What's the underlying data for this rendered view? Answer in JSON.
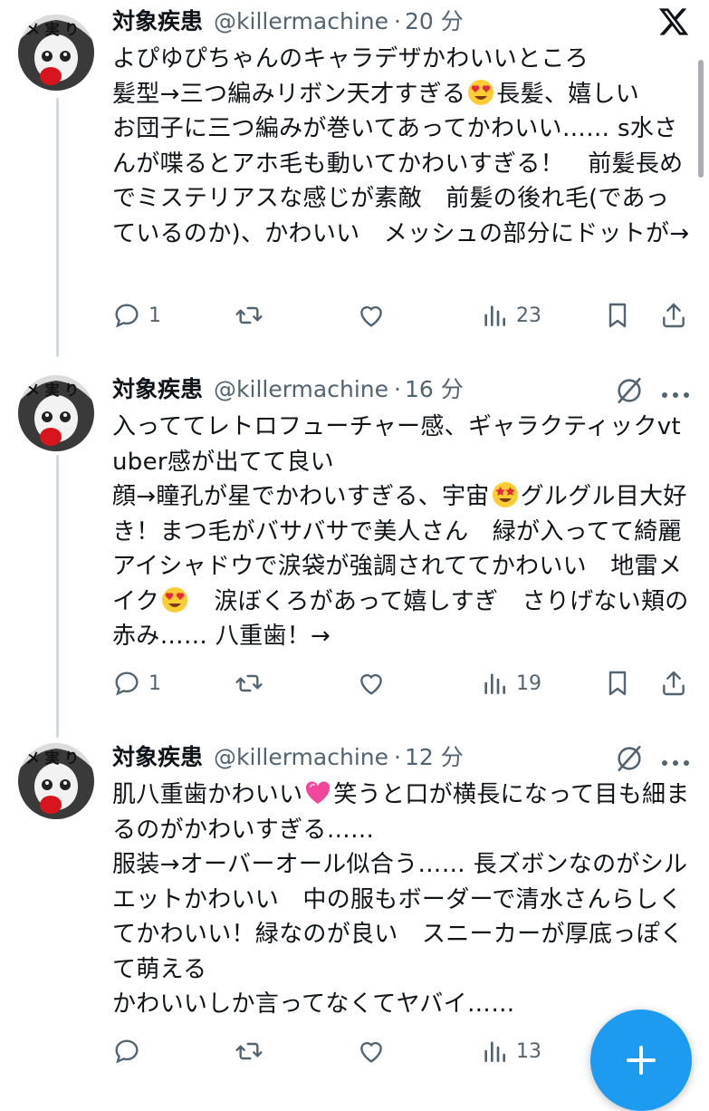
{
  "tweets": [
    {
      "display_name": "対象疾患",
      "handle": "@killermachine",
      "separator": "·",
      "time": "20 分",
      "text_parts": [
        "よぴゆぴちゃんのキャラデザかわいいところ\n髪型→三つ編みリボン天才すぎる",
        "長髪、嬉しい\nお団子に三つ編みが巻いてあってかわいい…… s水さんが喋るとアホ毛も動いてかわいすぎる！　前髪長めでミステリアスな感じが素敵　前髪の後れ毛(であっているのか)、かわいい　メッシュの部分にドットが→"
      ],
      "emojis": [
        "heart-eyes"
      ],
      "replies": "1",
      "reposts": "",
      "likes": "",
      "views": "23",
      "top_right_icon": "x-logo"
    },
    {
      "display_name": "対象疾患",
      "handle": "@killermachine",
      "separator": "·",
      "time": "16 分",
      "text_parts": [
        "入っててレトロフューチャー感、ギャラクティックvtuber感が出てて良い\n顔→瞳孔が星でかわいすぎる、宇宙",
        "グルグル目大好き！まつ毛がバサバサで美人さん　緑が入ってて綺麗　アイシャドウで涙袋が強調されててかわいい　地雷メイク",
        "　涙ぼくろがあって嬉しすぎ　さりげない頬の赤み…… 八重歯！→"
      ],
      "emojis": [
        "star-struck",
        "heart-eyes"
      ],
      "replies": "1",
      "reposts": "",
      "likes": "",
      "views": "19",
      "top_right_icon": "grok-icon"
    },
    {
      "display_name": "対象疾患",
      "handle": "@killermachine",
      "separator": "·",
      "time": "12 分",
      "text_parts": [
        "肌八重歯かわいい",
        "笑うと口が横長になって目も細まるのがかわいすぎる……\n服装→オーバーオール似合う…… 長ズボンなのがシルエットかわいい　中の服もボーダーで清水さんらしくてかわいい！緑なのが良い　スニーカーが厚底っぽくて萌える\nかわいいしか言ってなくてヤバイ……"
      ],
      "emojis": [
        "pink-heart"
      ],
      "replies": "",
      "reposts": "",
      "likes": "",
      "views": "13",
      "top_right_icon": "grok-icon"
    }
  ],
  "colors": {
    "text": "#0f1419",
    "secondary": "#536471",
    "thread_line": "#cfd9de",
    "fab": "#1d9bf0"
  },
  "fab_icon": "plus-icon"
}
